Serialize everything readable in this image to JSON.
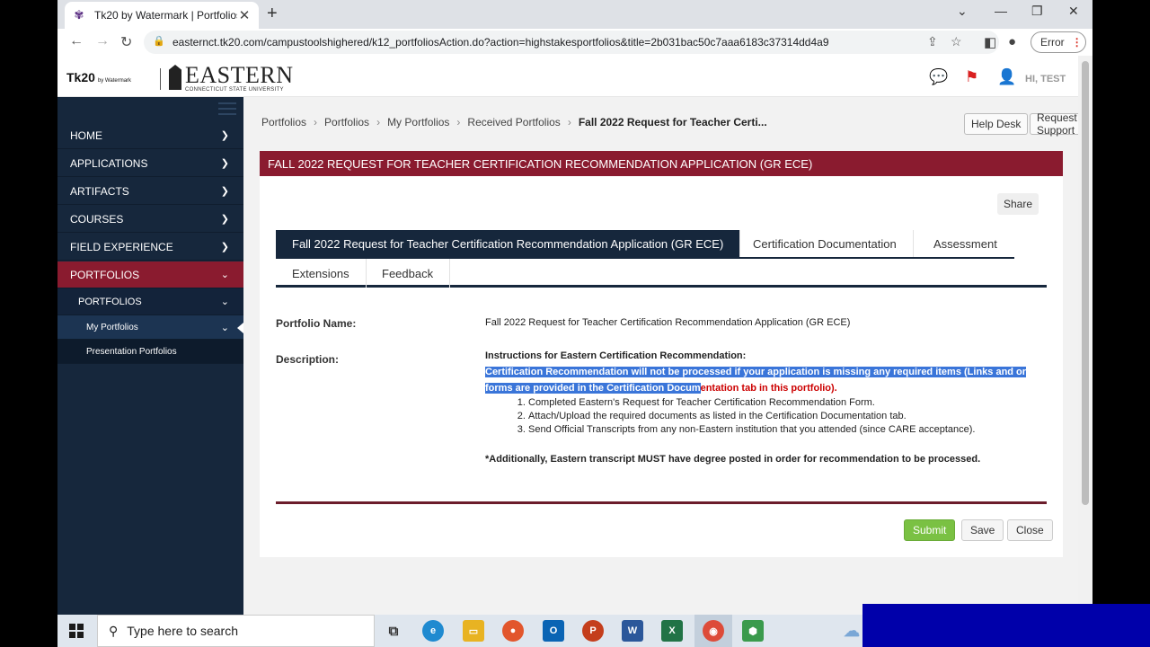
{
  "browser": {
    "tab_title": "Tk20 by Watermark | Portfolios",
    "url": "easternct.tk20.com/campustoolshighered/k12_portfoliosAction.do?action=highstakesportfolios&title=2b031bac50c7aaa6183c37314dd4a9",
    "error_label": "Error"
  },
  "header": {
    "tk20_logo": "Tk20",
    "tk20_sub": "by Watermark",
    "eastern_logo": "EASTERN",
    "eastern_sub": "CONNECTICUT STATE UNIVERSITY",
    "user_greeting": "HI, TEST"
  },
  "sidebar": {
    "items": [
      {
        "label": "HOME"
      },
      {
        "label": "APPLICATIONS"
      },
      {
        "label": "ARTIFACTS"
      },
      {
        "label": "COURSES"
      },
      {
        "label": "FIELD EXPERIENCE"
      },
      {
        "label": "PORTFOLIOS"
      }
    ],
    "sub_item": "PORTFOLIOS",
    "sub_sub_items": [
      "My Portfolios",
      "Presentation Portfolios"
    ]
  },
  "breadcrumb": [
    "Portfolios",
    "Portfolios",
    "My Portfolios",
    "Received Portfolios",
    "Fall 2022 Request for Teacher Certi..."
  ],
  "top_buttons": {
    "help_desk": "Help Desk",
    "request_support": "Request Support"
  },
  "page_title": "FALL 2022 REQUEST FOR TEACHER CERTIFICATION RECOMMENDATION APPLICATION (GR ECE)",
  "share_label": "Share",
  "tabs": [
    "Fall 2022 Request for Teacher Certification Recommendation Application (GR ECE)",
    "Certification Documentation",
    "Assessment",
    "Extensions",
    "Feedback"
  ],
  "form": {
    "portfolio_name_label": "Portfolio Name:",
    "portfolio_name_value": "Fall 2022 Request for Teacher Certification Recommendation Application (GR ECE)",
    "description_label": "Description:",
    "desc_heading": "Instructions for Eastern Certification Recommendation:",
    "desc_warning_selected": "Certification Recommendation will not be processed if your application is missing any required items (Links and or forms are provided in the Certification Docum",
    "desc_warning_rest": "entation tab in this portfolio).",
    "steps": [
      "Completed Eastern's Request for Teacher Certification Recommendation Form.",
      "Attach/Upload the required documents as listed in the Certification Documentation tab.",
      "Send Official Transcripts from any non-Eastern institution that you attended (since CARE acceptance)."
    ],
    "note": "*Additionally, Eastern transcript MUST have degree posted in order for recommendation to be processed."
  },
  "actions": {
    "submit": "Submit",
    "save": "Save",
    "close": "Close"
  },
  "taskbar": {
    "search_placeholder": "Type here to search"
  },
  "colors": {
    "sidebar": "#16273c",
    "accent": "#8a1b2f",
    "submit": "#7ac143",
    "selection": "#3a75d9"
  }
}
